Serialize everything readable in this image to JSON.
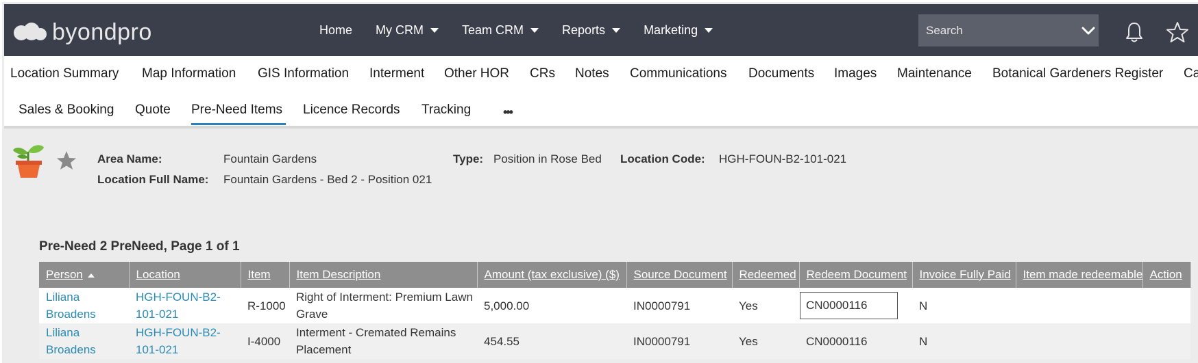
{
  "app": {
    "logo_text": "byondpro",
    "nav": [
      {
        "label": "Home",
        "dropdown": false
      },
      {
        "label": "My CRM",
        "dropdown": true
      },
      {
        "label": "Team CRM",
        "dropdown": true
      },
      {
        "label": "Reports",
        "dropdown": true
      },
      {
        "label": "Marketing",
        "dropdown": true
      }
    ],
    "search_placeholder": "Search"
  },
  "tabs_row1": [
    "Location Summary",
    "Map Information",
    "GIS Information",
    "Interment",
    "Other HOR",
    "CRs",
    "Notes",
    "Communications",
    "Documents",
    "Images",
    "Maintenance",
    "Botanical Gardeners Register",
    "Ca"
  ],
  "tabs_row2": [
    "Sales & Booking",
    "Quote",
    "Pre-Need Items",
    "Licence Records",
    "Tracking"
  ],
  "active_tab": "Pre-Need Items",
  "header": {
    "area_name_label": "Area Name:",
    "area_name": "Fountain Gardens",
    "type_label": "Type:",
    "type": "Position in Rose Bed",
    "location_code_label": "Location Code:",
    "location_code": "HGH-FOUN-B2-101-021",
    "full_name_label": "Location Full Name:",
    "full_name": "Fountain Gardens - Bed 2 - Position 021"
  },
  "section_title": "Pre-Need 2 PreNeed, Page 1 of 1",
  "table": {
    "columns": [
      "Person",
      "Location",
      "Item",
      "Item Description",
      "Amount (tax exclusive) ($)",
      "Source Document",
      "Redeemed",
      "Redeem Document",
      "Invoice Fully Paid",
      "Item made redeemable",
      "Action"
    ],
    "rows": [
      {
        "person": "Liliana Broadens",
        "location": "HGH-FOUN-B2-101-021",
        "item": "R-1000",
        "description": "Right of Interment: Premium Lawn Grave",
        "amount": "5,000.00",
        "source_document": "IN0000791",
        "redeemed": "Yes",
        "redeem_document": "CN0000116",
        "invoice_fully_paid": "N",
        "item_made_redeemable": "",
        "action": ""
      },
      {
        "person": "Liliana Broadens",
        "location": "HGH-FOUN-B2-101-021",
        "item": "I-4000",
        "description": "Interment - Cremated Remains Placement",
        "amount": "454.55",
        "source_document": "IN0000791",
        "redeemed": "Yes",
        "redeem_document": "CN0000116",
        "invoice_fully_paid": "N",
        "item_made_redeemable": "",
        "action": ""
      }
    ]
  },
  "colors": {
    "navbar_bg": "#3a3f4b",
    "accent_blue": "#2d7fb8",
    "link": "#2a8bb5",
    "table_header_bg": "#8e8e8e"
  }
}
